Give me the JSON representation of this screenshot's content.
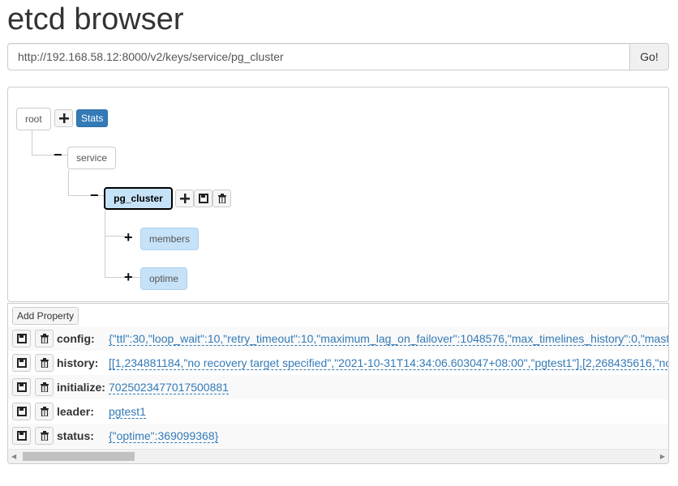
{
  "app": {
    "title": "etcd browser"
  },
  "url_bar": {
    "value": "http://192.168.58.12:8000/v2/keys/service/pg_cluster",
    "go_label": "Go!"
  },
  "tree": {
    "root_label": "root",
    "stats_label": "Stats",
    "service_label": "service",
    "selected_label": "pg_cluster",
    "children": [
      {
        "label": "members"
      },
      {
        "label": "optime"
      }
    ]
  },
  "properties": {
    "add_label": "Add Property",
    "rows": [
      {
        "key": "config:",
        "value": "{\"ttl\":30,\"loop_wait\":10,\"retry_timeout\":10,\"maximum_lag_on_failover\":1048576,\"max_timelines_history\":0,\"mast"
      },
      {
        "key": "history:",
        "value": "[[1,234881184,\"no recovery target specified\",\"2021-10-31T14:34:06.603047+08:00\",\"pgtest1\"],[2,268435616,\"no"
      },
      {
        "key": "initialize:",
        "value": "7025023477017500881"
      },
      {
        "key": "leader:",
        "value": "pgtest1"
      },
      {
        "key": "status:",
        "value": "{\"optime\":369099368}"
      }
    ]
  },
  "scrollbar": {
    "position": 0
  }
}
